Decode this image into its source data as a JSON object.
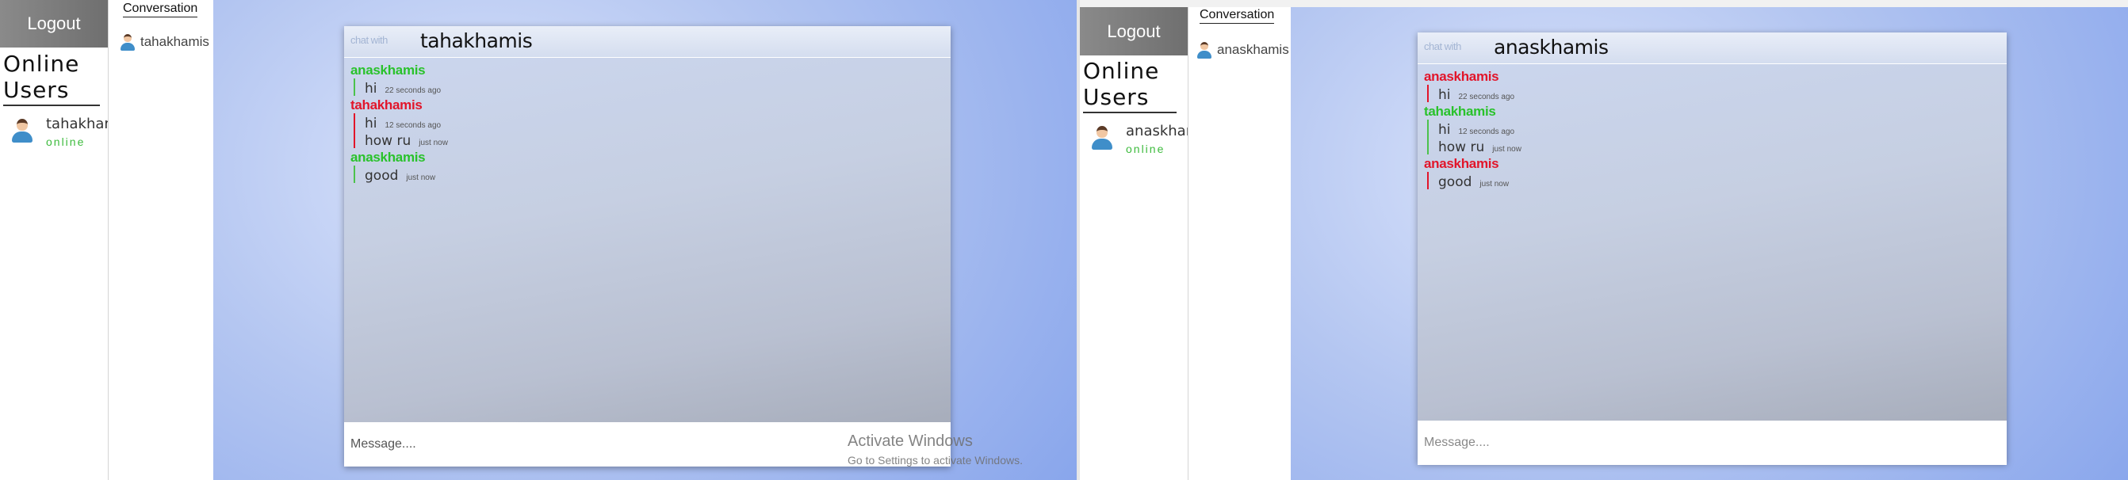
{
  "left": {
    "logout_label": "Logout",
    "online_users_title": "Online Users",
    "online_user": {
      "name": "tahakhamis",
      "status": "online"
    },
    "conversation_title": "Conversation",
    "conversation_user": "tahakhamis",
    "chat": {
      "with_label": "chat with",
      "title": "tahakhamis",
      "messages": [
        {
          "sender": "anaskhamis",
          "color": "#29c22b",
          "lines": [
            {
              "text": "hi",
              "time": "22 seconds ago"
            }
          ]
        },
        {
          "sender": "tahakhamis",
          "color": "#e2152a",
          "lines": [
            {
              "text": "hi",
              "time": "12 seconds ago"
            },
            {
              "text": "how ru",
              "time": "just now"
            }
          ]
        },
        {
          "sender": "anaskhamis",
          "color": "#29c22b",
          "lines": [
            {
              "text": "good",
              "time": "just now"
            }
          ]
        }
      ],
      "input_placeholder": "Message...."
    },
    "activate_windows": {
      "title": "Activate Windows",
      "subtitle": "Go to Settings to activate Windows."
    }
  },
  "right": {
    "logout_label": "Logout",
    "online_users_title": "Online Users",
    "online_user": {
      "name": "anaskhamis",
      "status": "online"
    },
    "conversation_title": "Conversation",
    "conversation_user": "anaskhamis",
    "chat": {
      "with_label": "chat with",
      "title": "anaskhamis",
      "messages": [
        {
          "sender": "anaskhamis",
          "color": "#e2152a",
          "lines": [
            {
              "text": "hi",
              "time": "22 seconds ago"
            }
          ]
        },
        {
          "sender": "tahakhamis",
          "color": "#29c22b",
          "lines": [
            {
              "text": "hi",
              "time": "12 seconds ago"
            },
            {
              "text": "how ru",
              "time": "just now"
            }
          ]
        },
        {
          "sender": "anaskhamis",
          "color": "#e2152a",
          "lines": [
            {
              "text": "good",
              "time": "just now"
            }
          ]
        }
      ],
      "input_placeholder": "Message...."
    }
  }
}
